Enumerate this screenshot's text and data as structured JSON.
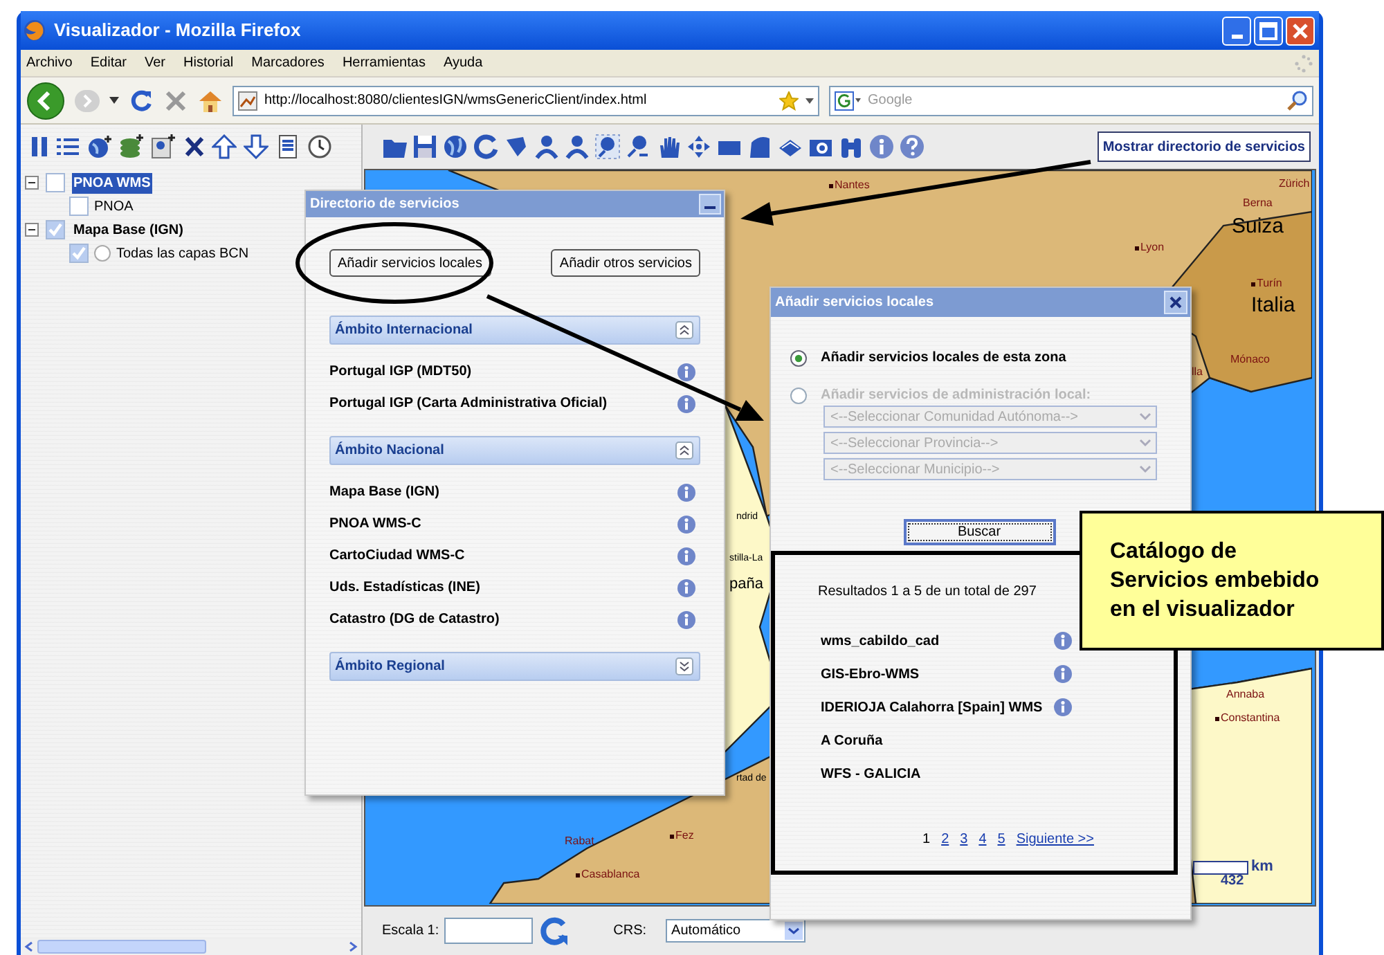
{
  "window": {
    "title": "Visualizador - Mozilla Firefox"
  },
  "menu": [
    "Archivo",
    "Editar",
    "Ver",
    "Historial",
    "Marcadores",
    "Herramientas",
    "Ayuda"
  ],
  "address_bar": {
    "url": "http://localhost:8080/clientesIGN/wmsGenericClient/index.html"
  },
  "search": {
    "placeholder": "Google"
  },
  "layer_tree": [
    {
      "label": "PNOA WMS",
      "checked": false,
      "selected": true,
      "children": [
        {
          "label": "PNOA",
          "checked": false
        }
      ]
    },
    {
      "label": "Mapa Base (IGN)",
      "checked": true,
      "selected": false,
      "children": [
        {
          "label": "Todas las capas BCN",
          "checked": true,
          "radio_selected": false
        }
      ]
    }
  ],
  "toolbar_button": "Mostrar directorio de servicios",
  "map_labels": [
    {
      "text": "Nantes",
      "kind": "city"
    },
    {
      "text": "Zürich",
      "kind": "place"
    },
    {
      "text": "Berna",
      "kind": "place"
    },
    {
      "text": "Suiza",
      "kind": "country"
    },
    {
      "text": "Lyon",
      "kind": "city"
    },
    {
      "text": "Turín",
      "kind": "city"
    },
    {
      "text": "Italia",
      "kind": "country"
    },
    {
      "text": "Mónaco",
      "kind": "place"
    },
    {
      "text": "lla",
      "kind": "place"
    },
    {
      "text": "ndrid",
      "kind": "area"
    },
    {
      "text": "stilla-La",
      "kind": "area"
    },
    {
      "text": "paña",
      "kind": "fragment"
    },
    {
      "text": "rtad de",
      "kind": "area"
    },
    {
      "text": "Rabat",
      "kind": "place"
    },
    {
      "text": "Fez",
      "kind": "city"
    },
    {
      "text": "Casablanca",
      "kind": "city"
    },
    {
      "text": "Annaba",
      "kind": "place"
    },
    {
      "text": "Constantina",
      "kind": "city"
    }
  ],
  "scale_bar": {
    "unit": "km",
    "value": "432"
  },
  "bottom_bar": {
    "scale_label": "Escala 1:",
    "crs_label": "CRS:",
    "crs_value": "Automático"
  },
  "directory_dialog": {
    "title": "Directorio de servicios",
    "buttons": [
      "Añadir servicios locales",
      "Añadir otros servicios"
    ],
    "sections": [
      {
        "title": "Ámbito Internacional",
        "expanded": true,
        "items": [
          "Portugal IGP (MDT50)",
          "Portugal IGP (Carta Administrativa Oficial)"
        ]
      },
      {
        "title": "Ámbito Nacional",
        "expanded": true,
        "items": [
          "Mapa Base (IGN)",
          "PNOA WMS-C",
          "CartoCiudad WMS-C",
          "Uds. Estadísticas (INE)",
          "Catastro (DG de Catastro)"
        ]
      },
      {
        "title": "Ámbito Regional",
        "expanded": false
      }
    ]
  },
  "local_dialog": {
    "title": "Añadir servicios locales",
    "options": [
      {
        "label": "Añadir servicios locales de esta zona",
        "selected": true,
        "disabled": false
      },
      {
        "label": "Añadir servicios de administración local:",
        "selected": false,
        "disabled": true
      }
    ],
    "selects": [
      {
        "placeholder": "<--Seleccionar Comunidad Autónoma-->",
        "disabled": true
      },
      {
        "placeholder": "<--Seleccionar Provincia-->",
        "disabled": true
      },
      {
        "placeholder": "<--Seleccionar Municipio-->",
        "disabled": true
      }
    ],
    "search_button": "Buscar",
    "summary": "Resultados 1 a 5 de un total de 297",
    "results": [
      {
        "name": "wms_cabildo_cad",
        "info": true
      },
      {
        "name": "GIS-Ebro-WMS",
        "info": true
      },
      {
        "name": "IDERIOJA Calahorra [Spain] WMS",
        "info": true
      },
      {
        "name": "A Coruña",
        "info": false
      },
      {
        "name": "WFS - GALICIA",
        "info": false
      }
    ],
    "pages": [
      {
        "label": "1",
        "selected": true
      },
      {
        "label": "2",
        "selected": false
      },
      {
        "label": "3",
        "selected": false
      },
      {
        "label": "4",
        "selected": false
      },
      {
        "label": "5",
        "selected": false
      }
    ],
    "next": "Siguiente >>"
  },
  "callout": {
    "lines": [
      "Catálogo de",
      "Servicios embebido",
      "en el visualizador"
    ]
  }
}
